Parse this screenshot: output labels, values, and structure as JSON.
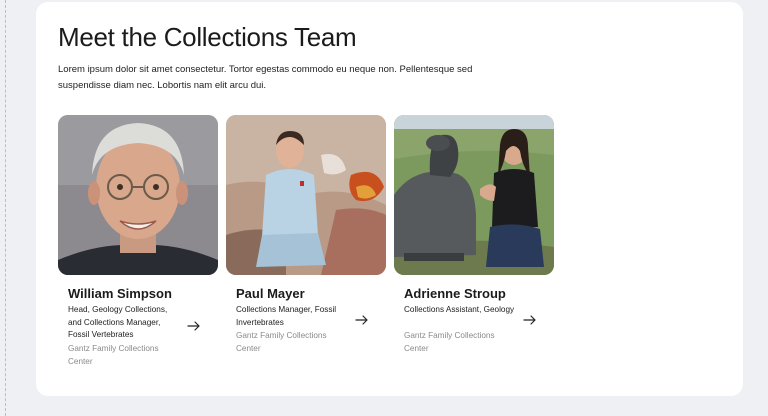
{
  "section": {
    "title": "Meet the Collections Team",
    "intro": "Lorem ipsum dolor sit amet consectetur. Tortor egestas commodo eu neque non. Pellentesque sed suspendisse diam nec. Lobortis nam elit arcu dui."
  },
  "team": [
    {
      "name": "William Simpson",
      "role": "Head, Geology Collections, and Collections Manager, Fossil Vertebrates",
      "center": "Gantz Family Collections Center",
      "photo": "portrait-gray-haired-man-glasses",
      "link_icon": "arrow-right-icon"
    },
    {
      "name": "Paul Mayer",
      "role": "Collections Manager, Fossil Invertebrates",
      "center": "Gantz Family Collections Center",
      "photo": "man-crouching-by-painted-rock",
      "link_icon": "arrow-right-icon"
    },
    {
      "name": "Adrienne Stroup",
      "role": "Collections Assistant, Geology",
      "center": "Gantz Family Collections Center",
      "photo": "woman-with-tortoise-sculpture",
      "link_icon": "arrow-right-icon"
    }
  ],
  "colors": {
    "page_bg": "#eef0f4",
    "card_bg": "#ffffff",
    "text": "#1b1b1b",
    "muted": "#8a8a8a"
  }
}
